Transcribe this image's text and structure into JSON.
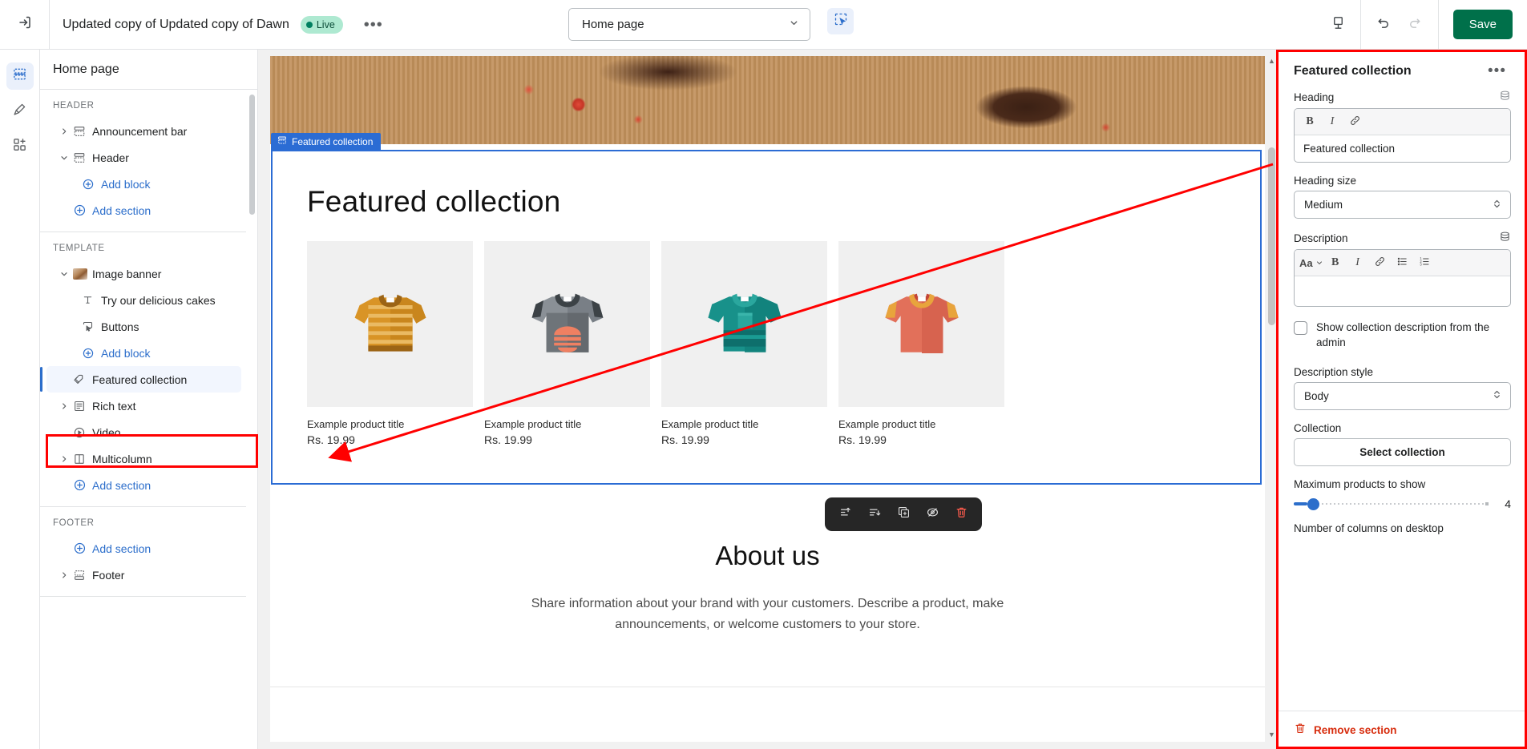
{
  "topbar": {
    "exit_icon": "exit-icon",
    "theme_name": "Updated copy of Updated copy of Dawn",
    "live_badge": "Live",
    "more_menu": "•••",
    "page_selector_value": "Home page",
    "inspector_icon": "inspector-cursor-icon",
    "device_icon": "desktop-device-icon",
    "undo_icon": "undo-icon",
    "redo_icon": "redo-icon",
    "save_label": "Save"
  },
  "rail": {
    "items": [
      {
        "icon": "sections-icon",
        "name": "sections",
        "active": true
      },
      {
        "icon": "paintbrush-icon",
        "name": "theme-settings",
        "active": false
      },
      {
        "icon": "apps-icon",
        "name": "apps",
        "active": false
      }
    ]
  },
  "sidebar": {
    "title": "Home page",
    "groups": [
      {
        "label": "HEADER",
        "rows": [
          {
            "label": "Announcement bar",
            "icon": "section-icon",
            "chevron": "right",
            "kind": "section"
          },
          {
            "label": "Header",
            "icon": "section-icon",
            "chevron": "down",
            "kind": "section"
          },
          {
            "label": "Add block",
            "icon": "plus-circle-icon",
            "kind": "link",
            "indent": true
          },
          {
            "label": "Add section",
            "icon": "plus-circle-icon",
            "kind": "link"
          }
        ]
      },
      {
        "label": "TEMPLATE",
        "rows": [
          {
            "label": "Image banner",
            "icon": "image-thumb-icon",
            "chevron": "down",
            "kind": "section"
          },
          {
            "label": "Try our delicious cakes",
            "icon": "text-icon",
            "kind": "block",
            "indent": true
          },
          {
            "label": "Buttons",
            "icon": "button-icon",
            "kind": "block",
            "indent": true
          },
          {
            "label": "Add block",
            "icon": "plus-circle-icon",
            "kind": "link",
            "indent": true
          },
          {
            "label": "Featured collection",
            "icon": "collection-icon",
            "kind": "section",
            "selected": true
          },
          {
            "label": "Rich text",
            "icon": "richtext-icon",
            "chevron": "right",
            "kind": "section"
          },
          {
            "label": "Video",
            "icon": "video-icon",
            "kind": "section"
          },
          {
            "label": "Multicolumn",
            "icon": "multicolumn-icon",
            "chevron": "right",
            "kind": "section"
          },
          {
            "label": "Add section",
            "icon": "plus-circle-icon",
            "kind": "link"
          }
        ]
      },
      {
        "label": "FOOTER",
        "rows": [
          {
            "label": "Add section",
            "icon": "plus-circle-icon",
            "kind": "link"
          },
          {
            "label": "Footer",
            "icon": "footer-icon",
            "chevron": "right",
            "kind": "section"
          }
        ]
      }
    ]
  },
  "canvas": {
    "section_tag": "Featured collection",
    "section_heading": "Featured collection",
    "products": [
      {
        "title": "Example product title",
        "price": "Rs. 19.99",
        "image": "tshirt-striped-orange"
      },
      {
        "title": "Example product title",
        "price": "Rs. 19.99",
        "image": "tshirt-gray-burger"
      },
      {
        "title": "Example product title",
        "price": "Rs. 19.99",
        "image": "tshirt-teal-pocket"
      },
      {
        "title": "Example product title",
        "price": "Rs. 19.99",
        "image": "tshirt-coral-ringer"
      }
    ],
    "about_heading": "About us",
    "about_text": "Share information about your brand with your customers. Describe a product, make announcements, or welcome customers to your store.",
    "toolbar": [
      {
        "icon": "move-up-icon",
        "name": "move-section-up"
      },
      {
        "icon": "move-down-icon",
        "name": "move-section-down"
      },
      {
        "icon": "duplicate-icon",
        "name": "duplicate-section"
      },
      {
        "icon": "hide-eye-icon",
        "name": "hide-section"
      },
      {
        "icon": "trash-icon",
        "name": "delete-section"
      }
    ]
  },
  "panel": {
    "title": "Featured collection",
    "more_menu": "•••",
    "heading_label": "Heading",
    "heading_value": "Featured collection",
    "heading_toolbar": [
      "B",
      "I",
      "link-icon"
    ],
    "heading_size_label": "Heading size",
    "heading_size_value": "Medium",
    "description_label": "Description",
    "description_value": "",
    "description_toolbar": [
      "Aa",
      "B",
      "I",
      "link-icon",
      "bullet-list-icon",
      "numbered-list-icon"
    ],
    "show_collection_desc_label": "Show collection description from the admin",
    "show_collection_desc_checked": false,
    "description_style_label": "Description style",
    "description_style_value": "Body",
    "collection_label": "Collection",
    "select_collection_label": "Select collection",
    "max_products_label": "Maximum products to show",
    "max_products_value": "4",
    "columns_label": "Number of columns on desktop",
    "remove_section_label": "Remove section"
  },
  "colors": {
    "accent_blue": "#2c6ecb",
    "save_green": "#00704a",
    "live_badge_bg": "#aee9d1",
    "danger_red": "#d72c0d",
    "annotation_red": "#ff0000",
    "selection_blue": "#2b6cd4"
  }
}
